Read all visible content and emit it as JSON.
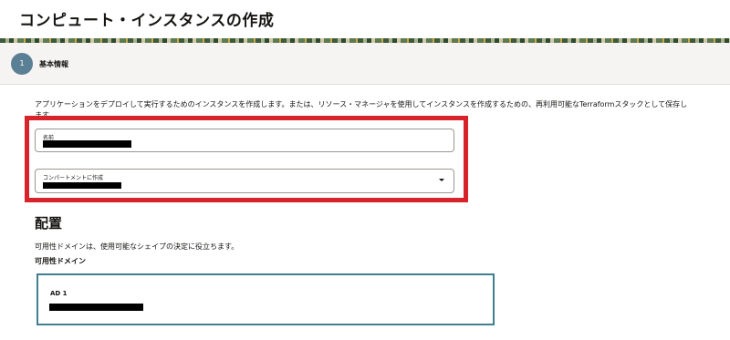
{
  "page": {
    "title": "コンピュート・インスタンスの作成"
  },
  "steps": [
    {
      "number": "1",
      "label": "基本情報"
    }
  ],
  "form": {
    "description": "アプリケーションをデプロイして実行するためのインスタンスを作成します。または、リソース・マネージャを使用してインスタンスを作成するための、再利用可能なTerraformスタックとして保存します。",
    "name_field": {
      "label": "名前"
    },
    "compartment_field": {
      "label": "コンパートメントに作成"
    }
  },
  "placement": {
    "title": "配置",
    "description": "可用性ドメインは、使用可能なシェイプの決定に役立ちます。",
    "ad_label": "可用性ドメイン",
    "domains": [
      {
        "name": "AD 1"
      }
    ]
  },
  "colors": {
    "highlight": "#d9232b",
    "step_badge": "#5b7f95",
    "selected_card_border": "#3f7f8f"
  },
  "icons": {
    "dropdown": "chevron-down-icon"
  }
}
